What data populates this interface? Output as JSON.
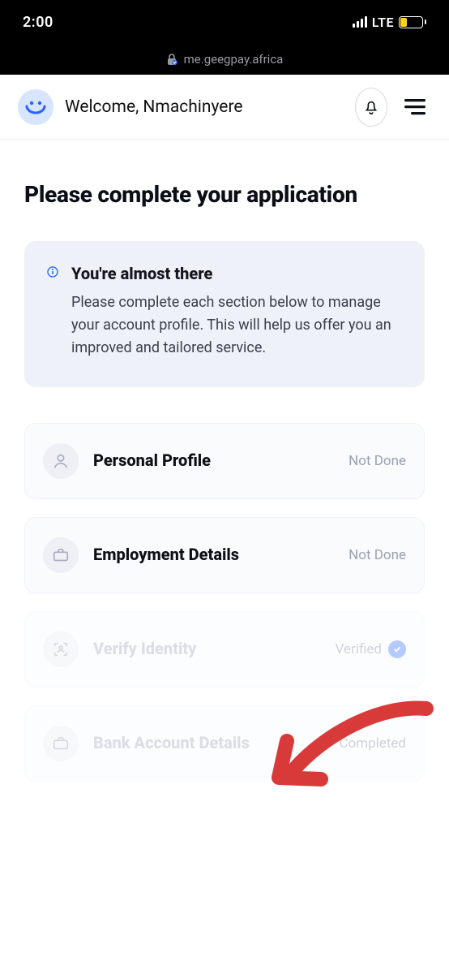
{
  "statusbar": {
    "time": "2:00",
    "network": "LTE",
    "battery": "32"
  },
  "browser": {
    "host": "me.geegpay.africa"
  },
  "header": {
    "welcome": "Welcome, Nmachinyere"
  },
  "page": {
    "title": "Please complete your application"
  },
  "info": {
    "title": "You're almost there",
    "body": "Please complete each section below to manage your account profile. This will help us offer you an improved and tailored service."
  },
  "sections": {
    "personal": {
      "label": "Personal Profile",
      "status": "Not Done"
    },
    "employment": {
      "label": "Employment Details",
      "status": "Not Done"
    },
    "verify": {
      "label": "Verify Identity",
      "status": "Verified"
    },
    "bank": {
      "label": "Bank Account Details",
      "status": "Completed"
    }
  }
}
